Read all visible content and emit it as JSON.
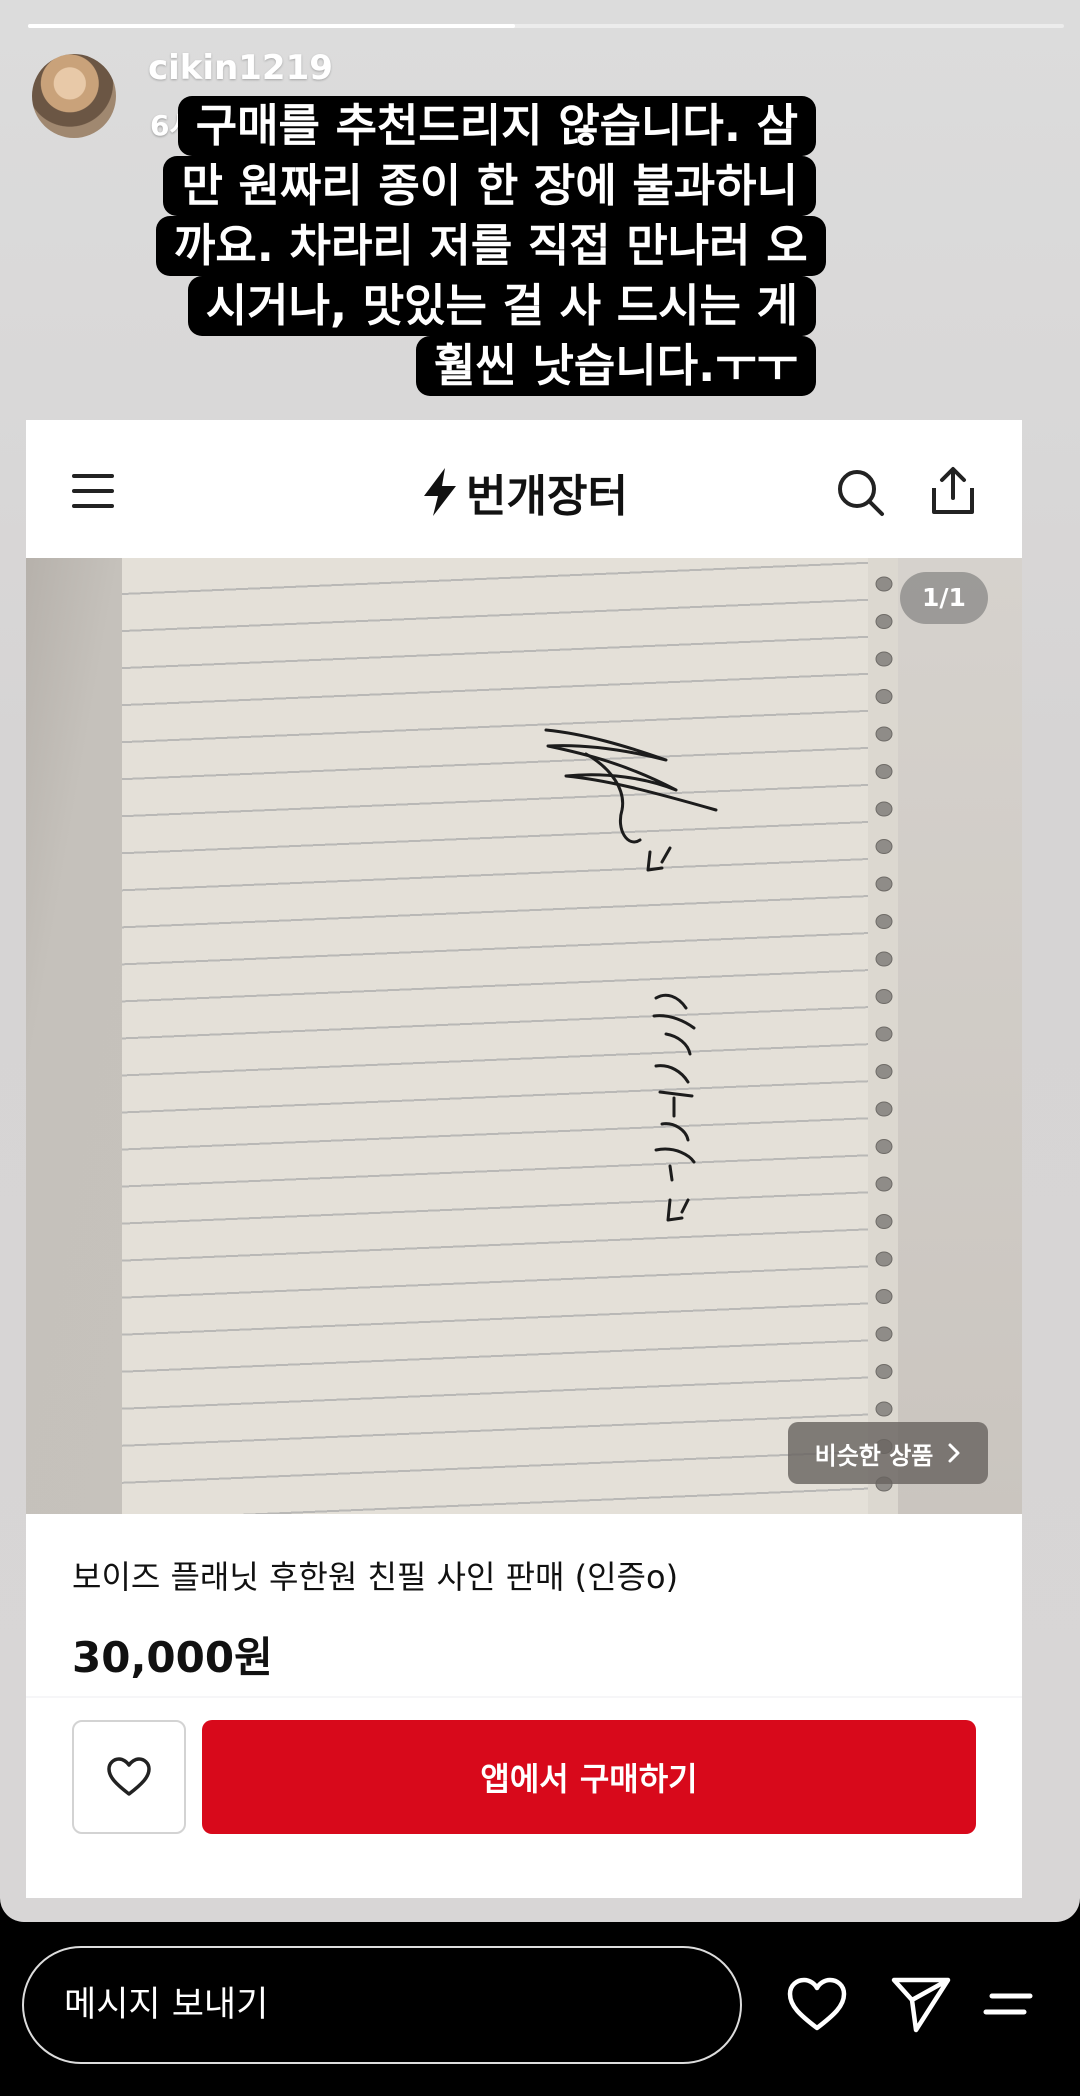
{
  "story": {
    "progress": 0.47,
    "username": "cikin1219",
    "time": "6시간 전",
    "caption_lines": [
      "구매를 추천드리지 않습니다. 삼",
      "만 원짜리 종이 한 장에 불과하니",
      "까요. 차라리 저를 직접 만나러 오",
      "시거나, 맛있는 걸 사 드시는 게",
      "훨씬 낫습니다.ㅜㅜ"
    ]
  },
  "listing": {
    "brand": "번개장터",
    "image_counter": "1/1",
    "similar_label": "비슷한 상품",
    "title": "보이즈 플래닛 후한원 친필 사인 판매 (인증o)",
    "price": "30,000원",
    "buy_label": "앱에서 구매하기",
    "accent_color": "#d8091b"
  },
  "reply": {
    "placeholder": "메시지 보내기"
  },
  "icons": [
    "menu-icon",
    "bolt-icon",
    "search-icon",
    "share-icon",
    "chevron-right-icon",
    "heart-icon",
    "send-icon",
    "more-icon"
  ]
}
